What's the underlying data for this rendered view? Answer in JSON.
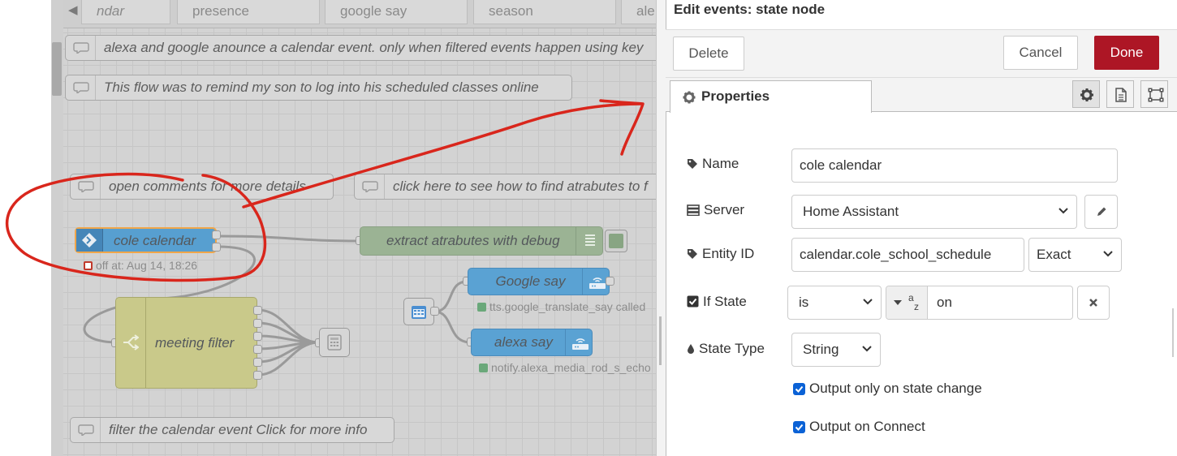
{
  "workspace": {
    "tabs": [
      {
        "label": "ndar",
        "partial": true
      },
      {
        "label": "presence"
      },
      {
        "label": "google say"
      },
      {
        "label": "season"
      },
      {
        "label": "ale"
      }
    ],
    "comments": {
      "c1": "alexa and google anounce a calendar event. only when filtered events happen using key",
      "c2": "This flow was to remind my son to log into his scheduled classes online",
      "c3": "open comments for more details",
      "c4": "click here to see how to find atrabutes to f",
      "c5": "filter the calendar event Click for more info"
    },
    "nodes": {
      "cole_calendar": {
        "label": "cole calendar",
        "status": "off at: Aug 14, 18:26",
        "color": "#3f93cf"
      },
      "extract": {
        "label": "extract atrabutes with debug",
        "color": "#87a980"
      },
      "google_say": {
        "label": "Google say",
        "status": "tts.google_translate_say called",
        "color": "#3f93cf"
      },
      "alexa_say": {
        "label": "alexa say",
        "status": "notify.alexa_media_rod_s_echo",
        "color": "#3f93cf"
      },
      "meeting_filter": {
        "label": "meeting filter",
        "color": "#c8c87a"
      }
    }
  },
  "panel": {
    "title": "Edit events: state node",
    "buttons": {
      "delete": "Delete",
      "cancel": "Cancel",
      "done": "Done"
    },
    "tabs": {
      "properties": "Properties"
    },
    "fields": {
      "name": {
        "label": "Name",
        "value": "cole calendar"
      },
      "server": {
        "label": "Server",
        "value": "Home Assistant"
      },
      "entity": {
        "label": "Entity ID",
        "value": "calendar.cole_school_schedule",
        "match": "Exact"
      },
      "if_state": {
        "label": "If State",
        "operator": "is",
        "type_glyph": "a z",
        "value": "on"
      },
      "state_type": {
        "label": "State Type",
        "value": "String"
      }
    },
    "checkboxes": {
      "state_change": {
        "label": "Output only on state change",
        "checked": true
      },
      "on_connect": {
        "label": "Output on Connect",
        "checked": true
      }
    },
    "colors": {
      "done": "#ad1625",
      "checkbox": "#0b62d6"
    }
  }
}
